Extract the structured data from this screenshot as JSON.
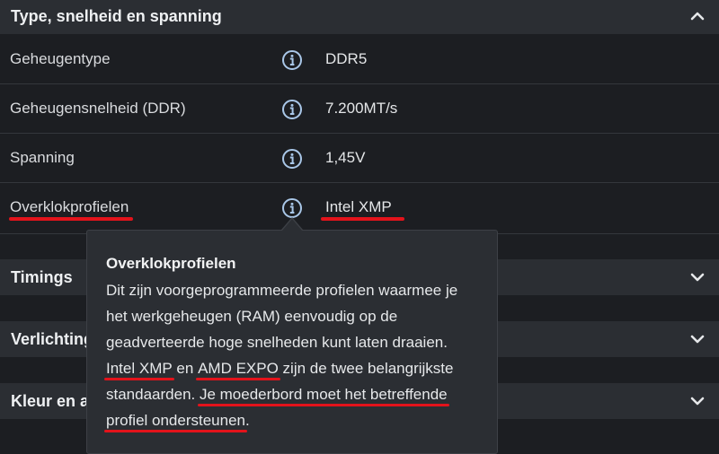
{
  "sections": {
    "type": {
      "title": "Type, snelheid en spanning",
      "icon": "chevron-up-icon"
    },
    "timings": {
      "title": "Timings",
      "icon": "chevron-down-icon"
    },
    "lighting": {
      "title": "Verlichting",
      "icon": "chevron-down-icon"
    },
    "color": {
      "title": "Kleur en a",
      "icon": "chevron-down-icon"
    }
  },
  "specs": [
    {
      "label": "Geheugentype",
      "value": "DDR5",
      "icon": "info-icon"
    },
    {
      "label": "Geheugensnelheid (DDR)",
      "value": "7.200MT/s",
      "icon": "info-icon"
    },
    {
      "label": "Spanning",
      "value": "1,45V",
      "icon": "info-icon"
    },
    {
      "label": "Overklokprofielen",
      "value": "Intel XMP",
      "icon": "info-icon"
    }
  ],
  "tooltip": {
    "title": "Overklokprofielen",
    "part1": "Dit zijn voorgeprogrammeerde profielen waarmee je het werkgeheugen (RAM) eenvoudig op de geadverteerde hoge snelheden kunt laten draaien. ",
    "mark1": "Intel XMP",
    "part2": " en ",
    "mark2": "AMD EXPO",
    "part3": " zijn de twee belangrijkste standaarden. ",
    "mark3a": "Je moederbord moet het betreffende",
    "mark3b": "profiel ondersteunen",
    "part4": "."
  },
  "colors": {
    "background": "#1c1e22",
    "header": "#2b2e33",
    "annotation_red": "#e3131b",
    "info_icon": "#a9c7e8"
  }
}
